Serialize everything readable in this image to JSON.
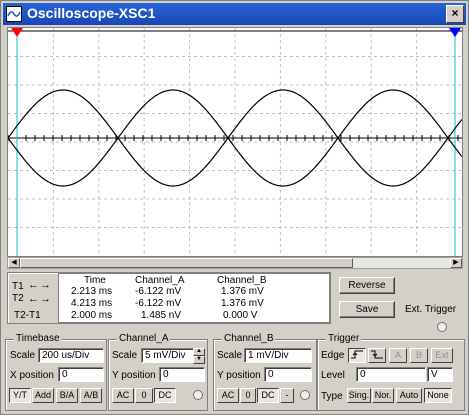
{
  "window": {
    "title": "Oscilloscope-XSC1",
    "close_label": "×"
  },
  "cursors": {
    "t1_label": "T1",
    "t2_label": "T2",
    "t2t1_label": "T2-T1",
    "left_arrow": "←",
    "right_arrow": "→"
  },
  "readout": {
    "headers": [
      "Time",
      "Channel_A",
      "Channel_B"
    ],
    "rows": [
      [
        "2.213 ms",
        "-6.122 mV",
        "1.376 mV"
      ],
      [
        "4.213 ms",
        "-6.122 mV",
        "1.376 mV"
      ],
      [
        "2.000 ms",
        "1.485 nV",
        "0.000 V"
      ]
    ]
  },
  "buttons": {
    "reverse": "Reverse",
    "save": "Save",
    "ext_trigger": "Ext. Trigger"
  },
  "timebase": {
    "title": "Timebase",
    "scale_label": "Scale",
    "scale_value": "200 us/Div",
    "xpos_label": "X position",
    "xpos_value": "0",
    "modes": [
      "Y/T",
      "Add",
      "B/A",
      "A/B"
    ]
  },
  "channel_a": {
    "title": "Channel_A",
    "scale_label": "Scale",
    "scale_value": "5 mV/Div",
    "ypos_label": "Y position",
    "ypos_value": "0",
    "coupling": [
      "AC",
      "0",
      "DC"
    ]
  },
  "channel_b": {
    "title": "Channel_B",
    "scale_label": "Scale",
    "scale_value": "1 mV/Div",
    "ypos_label": "Y position",
    "ypos_value": "0",
    "coupling": [
      "AC",
      "0",
      "DC",
      "-"
    ]
  },
  "trigger": {
    "title": "Trigger",
    "edge_label": "Edge",
    "edge_buttons": [
      "A",
      "B",
      "Ext"
    ],
    "level_label": "Level",
    "level_value": "0",
    "level_unit": "V",
    "type_label": "Type",
    "types": [
      "Sing.",
      "Nor.",
      "Auto",
      "None"
    ]
  },
  "colors": {
    "titlebar": "#1f55c6",
    "panel": "#d4d0c8",
    "trace": "#000000",
    "grid": "#c0c0c0",
    "cursor1": "#ff0000",
    "cursor2": "#0000ff"
  }
}
